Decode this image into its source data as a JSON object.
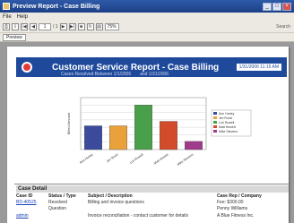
{
  "window": {
    "title": "Preview Report - Case Billing"
  },
  "menu": {
    "items": [
      "File",
      "Help"
    ]
  },
  "toolbar": {
    "page": "1",
    "of": "/ 1",
    "zoom": "75%",
    "search": "Search"
  },
  "subtoolbar": {
    "tab": "Preview"
  },
  "report": {
    "title": "Customer Service Report - Case Billing",
    "subtitle_left": "Cases Resolved Between 1/1/2006",
    "subtitle_right": "and 1/31/2006",
    "date": "1/31/2006 11:15 AM"
  },
  "chart_data": {
    "type": "bar",
    "categories": [
      "Ann Hurley",
      "Jim Rudd",
      "Lori Rowell",
      "Matt Hewett",
      "Mike Stevens"
    ],
    "values": [
      320,
      320,
      600,
      380,
      110
    ],
    "colors": [
      "#3b4a9a",
      "#e9a13b",
      "#4aa04a",
      "#d24b2a",
      "#a03a8a"
    ],
    "ylabel": "Billed Amount",
    "ylim": [
      0,
      700
    ],
    "grid": true,
    "legend": "right"
  },
  "section": {
    "title": "Case Detail"
  },
  "table": {
    "headers": [
      "Case ID",
      "Status / Type",
      "Subject / Description",
      "Case Rep / Company"
    ],
    "rows": [
      {
        "id": "BD-40525",
        "status": "Resolved",
        "subject": "Billing and invoice questions",
        "company": "Fee: $300.00"
      },
      {
        "id": "",
        "status": "Question",
        "subject": "",
        "company": "Penny Williams"
      },
      {
        "id": "admin",
        "status": "",
        "subject": "Invoice reconciliation - contact customer for details",
        "company": "A Blue Fitness Inc."
      }
    ]
  }
}
